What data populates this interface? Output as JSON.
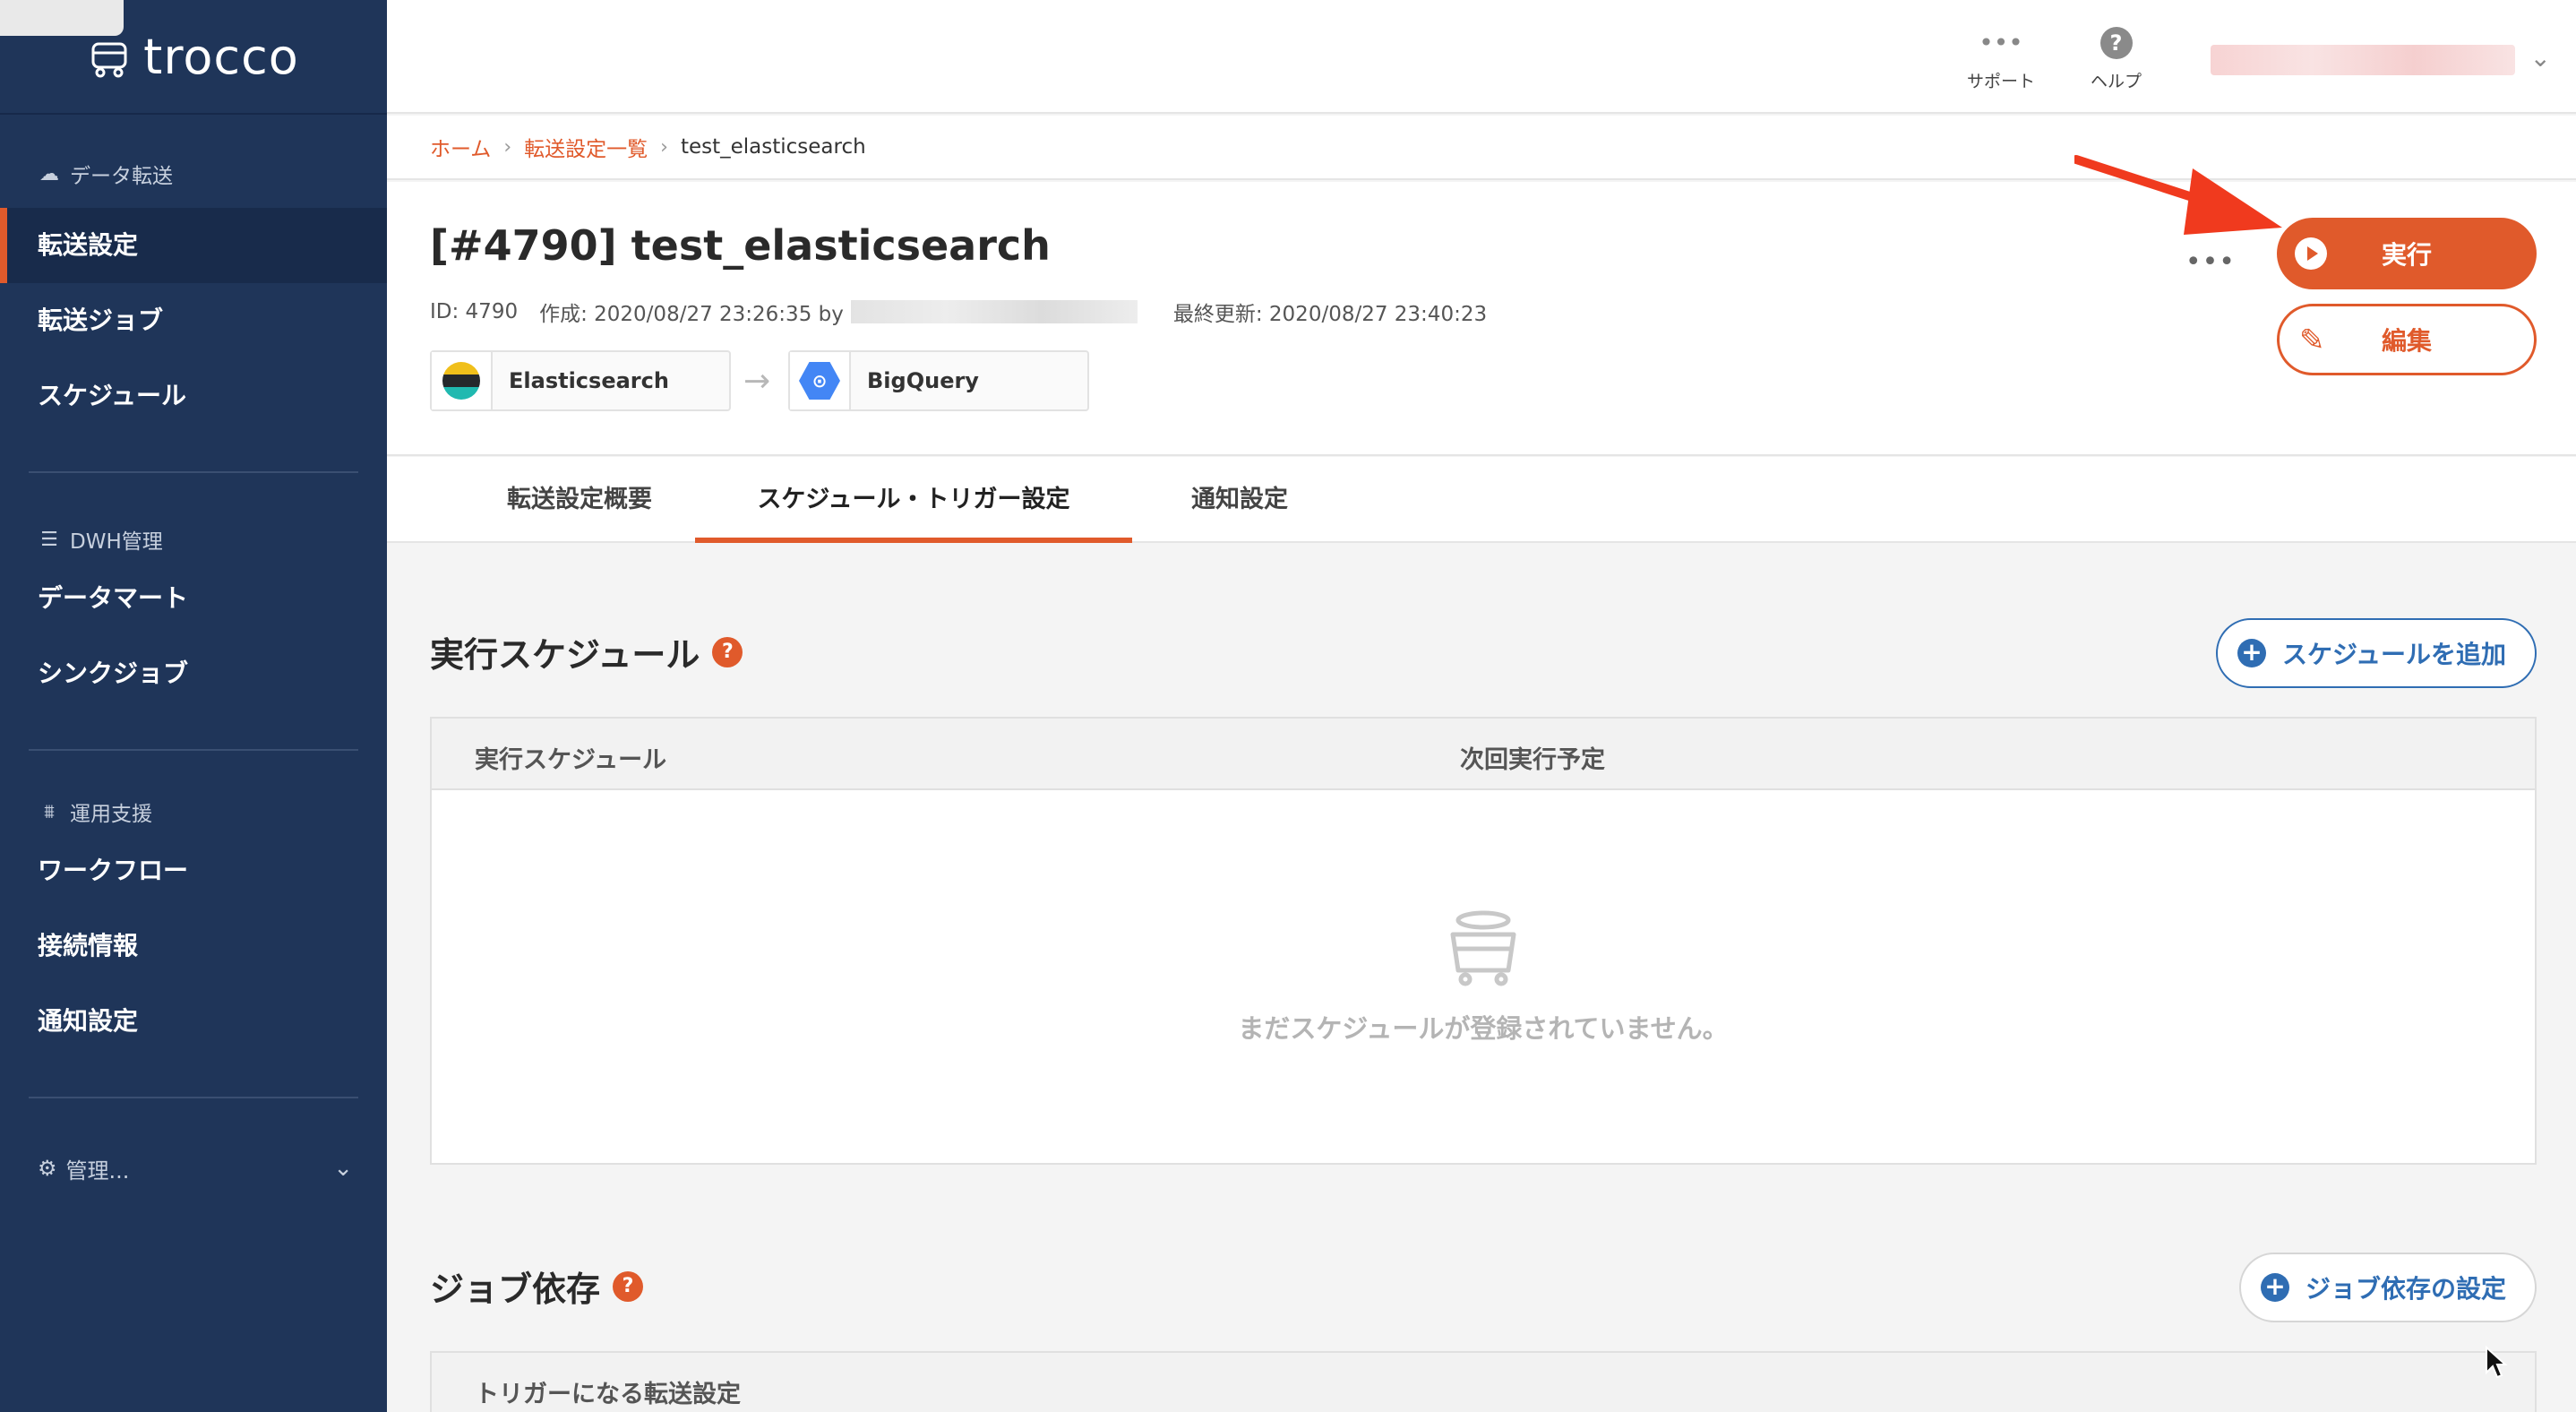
{
  "sidebar": {
    "logo": "trocco",
    "sections": [
      {
        "heading": "データ転送",
        "icon": "cloud-icon",
        "items": [
          "転送設定",
          "転送ジョブ",
          "スケジュール"
        ]
      },
      {
        "heading": "DWH管理",
        "icon": "list-icon",
        "items": [
          "データマート",
          "シンクジョブ"
        ]
      },
      {
        "heading": "運用支援",
        "icon": "sliders-icon",
        "items": [
          "ワークフロー",
          "接続情報",
          "通知設定"
        ]
      }
    ],
    "active_item": "転送設定",
    "admin_label": "管理..."
  },
  "topbar": {
    "support_label": "サポート",
    "help_label": "ヘルプ"
  },
  "breadcrumb": {
    "home": "ホーム",
    "list": "転送設定一覧",
    "current": "test_elasticsearch"
  },
  "header": {
    "title": "[#4790] test_elasticsearch",
    "id_text": "ID: 4790",
    "created_text": "作成: 2020/08/27 23:26:35 by",
    "updated_text": "最終更新: 2020/08/27 23:40:23",
    "source": "Elasticsearch",
    "destination": "BigQuery",
    "more_label": "•••",
    "run_label": "実行",
    "edit_label": "編集"
  },
  "tabs": [
    {
      "label": "転送設定概要",
      "active": false
    },
    {
      "label": "スケジュール・トリガー設定",
      "active": true
    },
    {
      "label": "通知設定",
      "active": false
    }
  ],
  "schedule": {
    "title": "実行スケジュール",
    "add_button": "スケジュールを追加",
    "columns": [
      "実行スケジュール",
      "次回実行予定"
    ],
    "empty_text": "まだスケジュールが登録されていません。"
  },
  "dependency": {
    "title": "ジョブ依存",
    "button": "ジョブ依存の設定",
    "column": "トリガーになる転送設定"
  },
  "colors": {
    "sidebar_bg": "#1f3559",
    "accent": "#e05a2b",
    "link_blue": "#2f6db3"
  }
}
